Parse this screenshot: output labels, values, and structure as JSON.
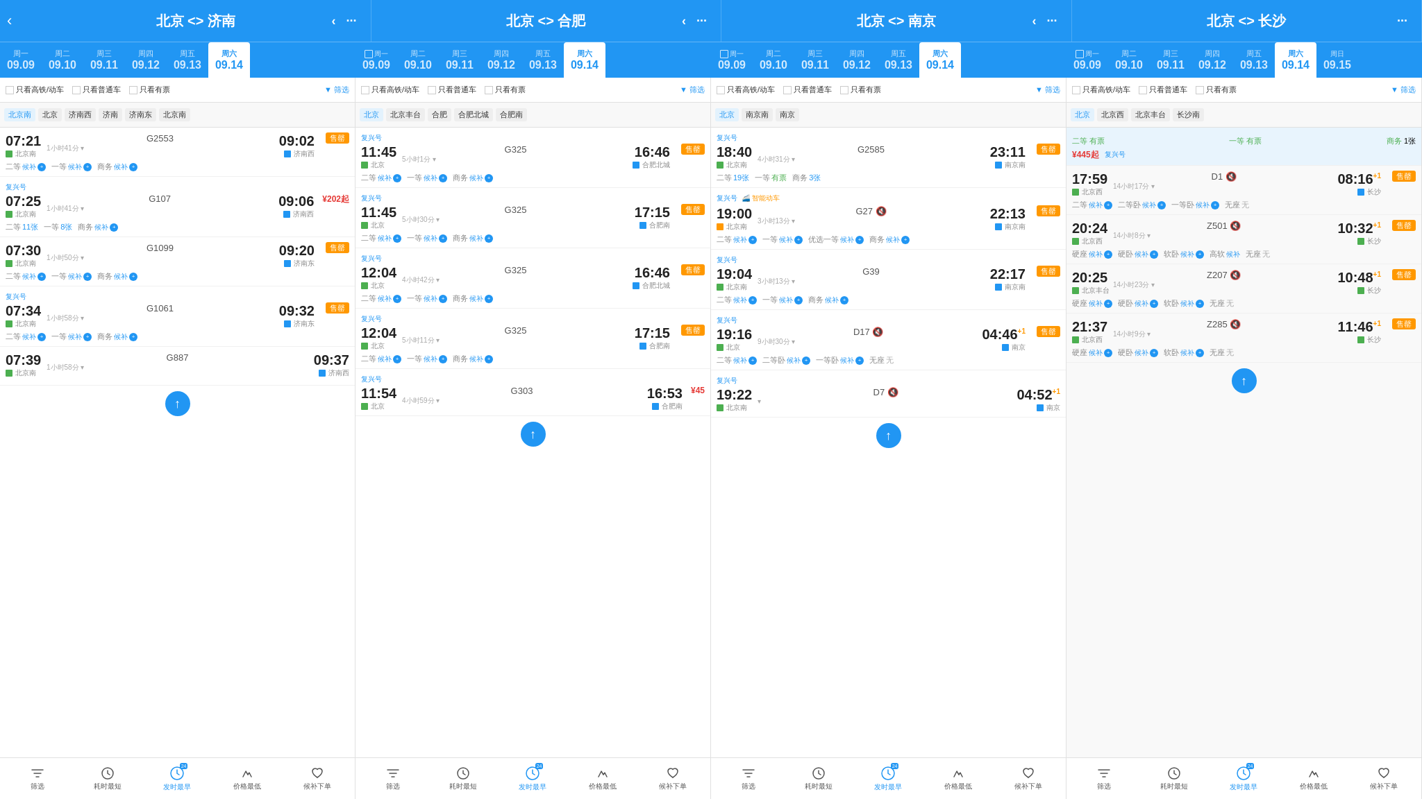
{
  "routes": [
    {
      "title": "北京 <> 济南",
      "id": "bj-jn"
    },
    {
      "title": "北京 <> 合肥",
      "id": "bj-hf"
    },
    {
      "title": "北京 <> 南京",
      "id": "bj-nj"
    },
    {
      "title": "北京 <> 长沙",
      "id": "bj-cs"
    }
  ],
  "days": [
    [
      "周一",
      "09.09"
    ],
    [
      "周二",
      "09.10"
    ],
    [
      "周三",
      "09.11"
    ],
    [
      "周四",
      "09.12"
    ],
    [
      "周五",
      "09.13"
    ],
    [
      "周六",
      "09.14"
    ]
  ],
  "filters": [
    "只看高铁/动车",
    "只看普通车",
    "只看有票"
  ],
  "stations": {
    "col1": [
      "北京南",
      "北京",
      "济南西",
      "济南",
      "济南东",
      "北京南"
    ],
    "col2": [
      "北京",
      "北京丰台",
      "合肥",
      "合肥北城",
      "合肥南"
    ],
    "col3": [
      "北京",
      "南京南",
      "南京"
    ],
    "col4": [
      "北京",
      "北京西",
      "北京丰台",
      "长沙南"
    ]
  },
  "trains_col1": [
    {
      "depTime": "07:21",
      "trainNum": "G2553",
      "arrTime": "09:02",
      "duration": "1小时41分",
      "depStation": "北京南",
      "arrStation": "济南西",
      "sellOut": true,
      "seats": [
        {
          "type": "二等",
          "status": "候补",
          "wait": true
        },
        {
          "type": "一等",
          "status": "候补",
          "wait": true
        },
        {
          "type": "商务",
          "status": "候补",
          "wait": true
        }
      ]
    },
    {
      "fuxing": true,
      "depTime": "07:25",
      "trainNum": "G107",
      "arrTime": "09:06",
      "duration": "1小时41分",
      "depStation": "北京南",
      "arrStation": "济南西",
      "price": "¥202起",
      "seats": [
        {
          "type": "二等",
          "count": "11张"
        },
        {
          "type": "一等",
          "count": "8张"
        },
        {
          "type": "商务",
          "status": "候补",
          "wait": true
        }
      ]
    },
    {
      "depTime": "07:30",
      "trainNum": "G1099",
      "arrTime": "09:20",
      "duration": "1小时50分",
      "depStation": "北京南",
      "arrStation": "济南东",
      "sellOut": true,
      "seats": [
        {
          "type": "二等",
          "status": "候补",
          "wait": true
        },
        {
          "type": "一等",
          "status": "候补",
          "wait": true
        },
        {
          "type": "商务",
          "status": "候补",
          "wait": true
        }
      ]
    },
    {
      "fuxing": true,
      "depTime": "07:34",
      "trainNum": "G1061",
      "arrTime": "09:32",
      "duration": "1小时58分",
      "depStation": "北京南",
      "arrStation": "济南东",
      "sellOut": true,
      "seats": [
        {
          "type": "二等",
          "status": "候补",
          "wait": true
        },
        {
          "type": "一等",
          "status": "候补",
          "wait": true
        },
        {
          "type": "商务",
          "status": "候补",
          "wait": true
        }
      ]
    },
    {
      "depTime": "07:39",
      "trainNum": "G887",
      "arrTime": "09:37",
      "duration": "1小时58分",
      "depStation": "北京南",
      "arrStation": "济南西",
      "seats": []
    }
  ],
  "trains_col2": [
    {
      "fuxing": true,
      "depTime": "11:45",
      "trainNum": "G325",
      "arrTime": "16:46",
      "duration": "5小时1分",
      "depStation": "北京",
      "arrStation": "合肥北城",
      "sellOut": true,
      "seats": [
        {
          "type": "二等",
          "status": "候补",
          "wait": true
        },
        {
          "type": "一等",
          "status": "候补",
          "wait": true
        },
        {
          "type": "商务",
          "status": "候补",
          "wait": true
        }
      ]
    },
    {
      "fuxing": true,
      "depTime": "11:45",
      "trainNum": "G325",
      "arrTime": "17:15",
      "duration": "5小时30分",
      "depStation": "北京",
      "arrStation": "合肥南",
      "sellOut": true,
      "seats": [
        {
          "type": "二等",
          "status": "候补",
          "wait": true
        },
        {
          "type": "一等",
          "status": "候补",
          "wait": true
        },
        {
          "type": "商务",
          "status": "候补",
          "wait": true
        }
      ]
    },
    {
      "fuxing": true,
      "depTime": "12:04",
      "trainNum": "G325",
      "arrTime": "16:46",
      "duration": "4小时42分",
      "depStation": "北京",
      "arrStation": "合肥北城",
      "sellOut": true,
      "seats": [
        {
          "type": "二等",
          "status": "候补",
          "wait": true
        },
        {
          "type": "一等",
          "status": "候补",
          "wait": true
        },
        {
          "type": "商务",
          "status": "候补",
          "wait": true
        }
      ]
    },
    {
      "fuxing": true,
      "depTime": "12:04",
      "trainNum": "G325",
      "arrTime": "17:15",
      "duration": "5小时11分",
      "depStation": "北京",
      "arrStation": "合肥南",
      "sellOut": true,
      "seats": [
        {
          "type": "二等",
          "status": "候补",
          "wait": true
        },
        {
          "type": "一等",
          "status": "候补",
          "wait": true
        },
        {
          "type": "商务",
          "status": "候补",
          "wait": true
        }
      ]
    },
    {
      "fuxing": true,
      "depTime": "11:54",
      "trainNum": "G303",
      "arrTime": "16:53",
      "duration": "4小时59分",
      "depStation": "北京",
      "arrStation": "合肥南",
      "price": "¥45",
      "seats": []
    }
  ],
  "trains_col3": [
    {
      "depTime": "18:40",
      "trainNum": "G2585",
      "arrTime": "23:11",
      "duration": "4小时31分",
      "depStation": "北京南",
      "arrStation": "南京南",
      "sellOut": true,
      "fuxing": true,
      "seats": [
        {
          "type": "二等",
          "count": "19张"
        },
        {
          "type": "一等",
          "status": "有票",
          "green": true
        },
        {
          "type": "商务",
          "count": "3张"
        }
      ]
    },
    {
      "fuxing": true,
      "smart": true,
      "depTime": "19:00",
      "trainNum": "G27",
      "arrTime": "22:13",
      "duration": "3小时13分",
      "depStation": "北京南",
      "arrStation": "南京南",
      "sellOut": true,
      "seats": [
        {
          "type": "二等",
          "status": "候补",
          "wait": true
        },
        {
          "type": "一等",
          "status": "候补",
          "wait": true
        },
        {
          "type": "优选一等",
          "status": "候补",
          "wait": true
        },
        {
          "type": "商务",
          "status": "候补",
          "wait": true
        }
      ]
    },
    {
      "fuxing": true,
      "depTime": "19:04",
      "trainNum": "G39",
      "arrTime": "22:17",
      "duration": "3小时13分",
      "depStation": "北京南",
      "arrStation": "南京南",
      "sellOut": true,
      "seats": [
        {
          "type": "二等",
          "status": "候补",
          "wait": true
        },
        {
          "type": "一等",
          "status": "候补",
          "wait": true
        },
        {
          "type": "商务",
          "status": "候补",
          "wait": true
        }
      ]
    },
    {
      "fuxing": true,
      "depTime": "19:16",
      "trainNum": "D17",
      "arrTime": "04:46+1",
      "duration": "9小时30分",
      "depStation": "北京",
      "arrStation": "南京",
      "sellOut": true,
      "seats": [
        {
          "type": "二等",
          "status": "候补",
          "wait": true
        },
        {
          "type": "二等卧",
          "status": "候补",
          "wait": true
        },
        {
          "type": "一等卧",
          "status": "候补",
          "wait": true
        },
        {
          "type": "无座",
          "status": "无"
        }
      ]
    },
    {
      "depTime": "19:22",
      "trainNum": "D7",
      "arrTime": "04:52+1",
      "duration": "",
      "depStation": "北京南",
      "arrStation": "南京",
      "seats": []
    }
  ],
  "trains_col4": [
    {
      "special": true,
      "header": {
        "line1": "二等 有票",
        "line2": "一等 有票",
        "line3": "商务 1张"
      },
      "price": "¥445起",
      "fuxingLabel": "复兴号"
    },
    {
      "depTime": "17:59",
      "trainNum": "D1",
      "arrTime": "08:16+1",
      "duration": "14小时17分",
      "depStation": "北京西",
      "arrStation": "长沙",
      "sellOut": true,
      "seats": [
        {
          "type": "二等",
          "status": "候补",
          "wait": true
        },
        {
          "type": "二等卧",
          "status": "候补",
          "wait": true
        },
        {
          "type": "一等卧",
          "status": "候补",
          "wait": true
        },
        {
          "type": "无座",
          "status": "无"
        }
      ]
    },
    {
      "depTime": "20:24",
      "trainNum": "Z501",
      "arrTime": "10:32+1",
      "duration": "14小时8分",
      "depStation": "北京西",
      "arrStation": "长沙",
      "sellOut": true,
      "seats": [
        {
          "type": "硬座",
          "status": "候补",
          "wait": true
        },
        {
          "type": "硬卧",
          "status": "候补",
          "wait": true
        },
        {
          "type": "软卧",
          "status": "候补",
          "wait": true
        },
        {
          "type": "高软",
          "status": "候补",
          "wait": true
        },
        {
          "type": "无座",
          "status": "无"
        }
      ]
    },
    {
      "depTime": "20:25",
      "trainNum": "Z207",
      "arrTime": "10:48+1",
      "duration": "14小时23分",
      "depStation": "北京丰台",
      "arrStation": "长沙",
      "sellOut": true,
      "seats": [
        {
          "type": "硬座",
          "status": "候补",
          "wait": true
        },
        {
          "type": "硬卧",
          "status": "候补",
          "wait": true
        },
        {
          "type": "软卧",
          "status": "候补",
          "wait": true
        },
        {
          "type": "无座",
          "status": "无"
        }
      ]
    },
    {
      "depTime": "21:37",
      "trainNum": "Z285",
      "arrTime": "11:46+1",
      "duration": "14小时9分",
      "depStation": "北京西",
      "arrStation": "长沙",
      "sellOut": true,
      "seats": []
    }
  ],
  "bottomBtns": [
    [
      {
        "label": "筛选",
        "icon": "▼",
        "active": false
      },
      {
        "label": "耗时最短",
        "icon": "⏱",
        "active": false
      },
      {
        "label": "发时最早",
        "icon": "⏰",
        "active": true,
        "has24": true
      },
      {
        "label": "价格最低",
        "icon": "💰",
        "active": false
      },
      {
        "label": "候补下单",
        "icon": "♡",
        "active": false
      }
    ],
    [
      {
        "label": "筛选",
        "icon": "▼",
        "active": false
      },
      {
        "label": "耗时最短",
        "icon": "⏱",
        "active": false
      },
      {
        "label": "发时最早",
        "icon": "⏰",
        "active": true,
        "has24": true
      },
      {
        "label": "价格最低",
        "icon": "💰",
        "active": false
      },
      {
        "label": "候补下单",
        "icon": "♡",
        "active": false
      }
    ],
    [
      {
        "label": "筛选",
        "icon": "▼",
        "active": false
      },
      {
        "label": "耗时最短",
        "icon": "⏱",
        "active": false
      },
      {
        "label": "发时最早",
        "icon": "⏰",
        "active": true,
        "has24": true
      },
      {
        "label": "价格最低",
        "icon": "💰",
        "active": false
      },
      {
        "label": "候补下单",
        "icon": "♡",
        "active": false
      }
    ],
    [
      {
        "label": "筛选",
        "icon": "▼",
        "active": false
      },
      {
        "label": "耗时最短",
        "icon": "⏱",
        "active": false
      },
      {
        "label": "发时最早",
        "icon": "⏰",
        "active": true,
        "has24": true
      },
      {
        "label": "价格最低",
        "icon": "💰",
        "active": false
      },
      {
        "label": "候补下单",
        "icon": "♡",
        "active": false
      }
    ]
  ]
}
